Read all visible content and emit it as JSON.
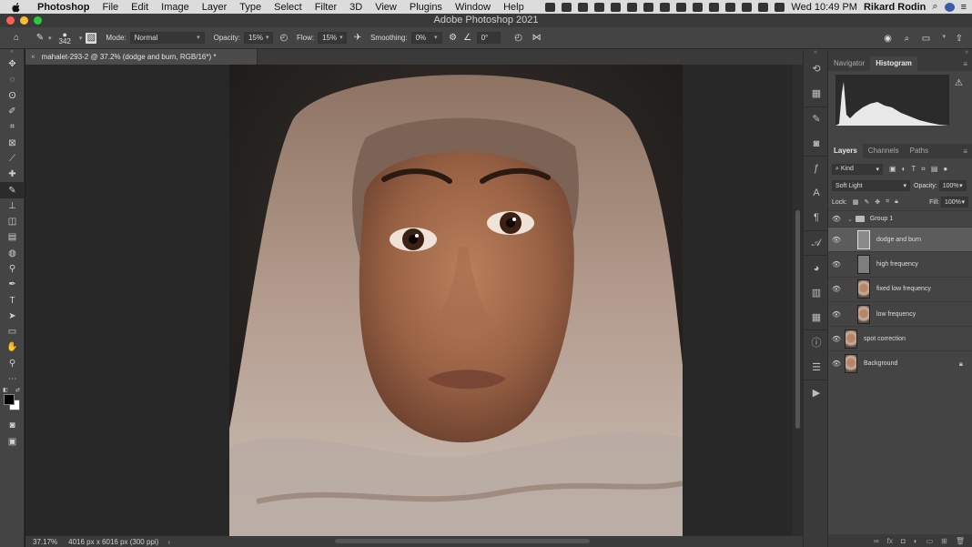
{
  "menubar": {
    "app": "Photoshop",
    "items": [
      "File",
      "Edit",
      "Image",
      "Layer",
      "Type",
      "Select",
      "Filter",
      "3D",
      "View",
      "Plugins",
      "Window",
      "Help"
    ],
    "datetime": "Wed 10:49 PM",
    "user": "Rikard Rodin"
  },
  "window": {
    "title": "Adobe Photoshop 2021"
  },
  "options": {
    "brush_size": "342",
    "mode_label": "Mode:",
    "mode_value": "Normal",
    "opacity_label": "Opacity:",
    "opacity_value": "15%",
    "flow_label": "Flow:",
    "flow_value": "15%",
    "smoothing_label": "Smoothing:",
    "smoothing_value": "0%",
    "angle_value": "0°"
  },
  "document": {
    "tab_title": "mahalet-293-2 @ 37.2% (dodge and burn, RGB/16*) *",
    "zoom": "37.17%",
    "dimensions": "4016 px x 6016 px (300 ppi)"
  },
  "panels": {
    "top_tabs": [
      "Navigator",
      "Histogram"
    ],
    "top_active": "Histogram",
    "layer_tabs": [
      "Layers",
      "Channels",
      "Paths"
    ],
    "layer_active": "Layers",
    "filter_kind": "Kind",
    "blend_mode": "Soft Light",
    "opacity_label": "Opacity:",
    "opacity_value": "100%",
    "lock_label": "Lock:",
    "fill_label": "Fill:",
    "fill_value": "100%"
  },
  "layers": {
    "group": "Group 1",
    "items": [
      "dodge and burn",
      "high frequency",
      "fixed low frequency",
      "low frequency",
      "spot correction",
      "Background"
    ],
    "selected": "dodge and burn"
  },
  "colors": {
    "accent_red": "#fe5f57",
    "accent_yellow": "#febc2e",
    "accent_green": "#28c840",
    "panel_bg": "#444444",
    "selected_layer": "#5c5c5c"
  }
}
